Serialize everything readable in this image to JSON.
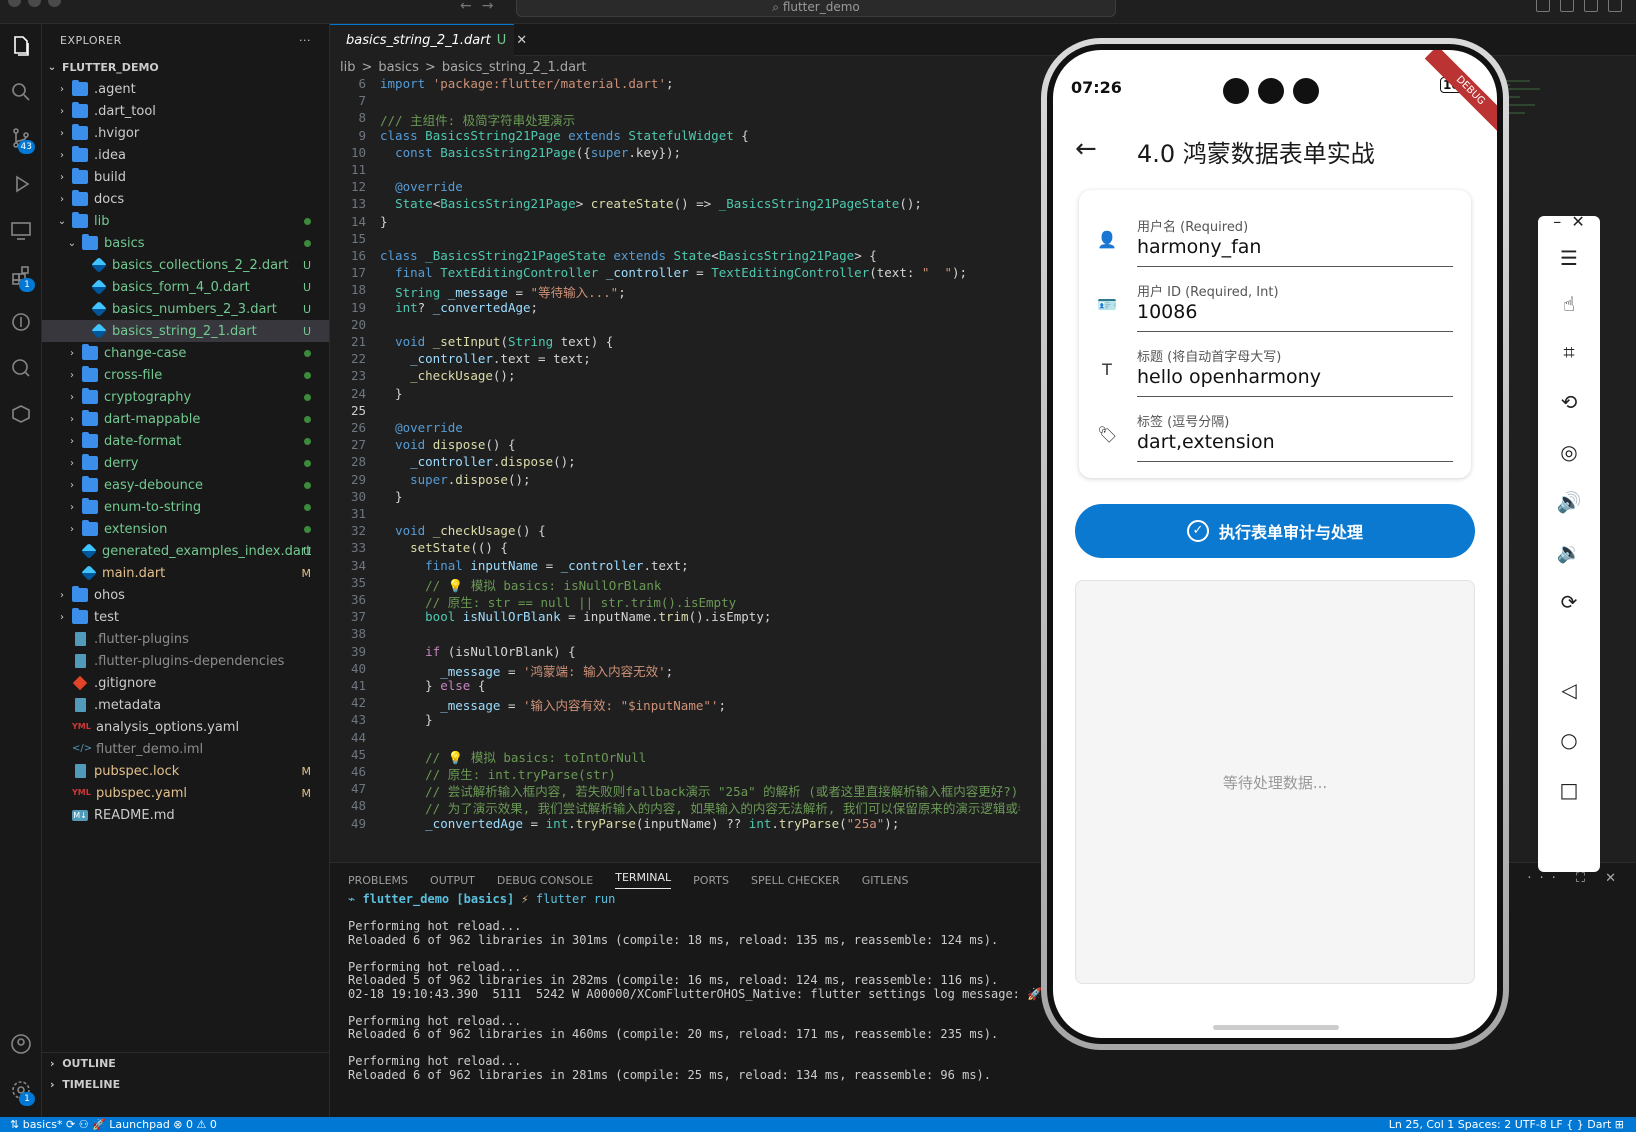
{
  "window": {
    "search": "flutter_demo"
  },
  "explorer": {
    "title": "EXPLORER",
    "more": "···",
    "root": "FLUTTER_DEMO",
    "items": [
      {
        "label": ".agent",
        "kind": "folder",
        "depth": 0,
        "open": false,
        "status": ""
      },
      {
        "label": ".dart_tool",
        "kind": "folder",
        "depth": 0,
        "open": false,
        "status": ""
      },
      {
        "label": ".hvigor",
        "kind": "folder",
        "depth": 0,
        "open": false,
        "status": ""
      },
      {
        "label": ".idea",
        "kind": "folder",
        "depth": 0,
        "open": false,
        "status": ""
      },
      {
        "label": "build",
        "kind": "folder",
        "depth": 0,
        "open": false,
        "status": ""
      },
      {
        "label": "docs",
        "kind": "folder",
        "depth": 0,
        "open": false,
        "status": ""
      },
      {
        "label": "lib",
        "kind": "folder",
        "depth": 0,
        "open": true,
        "status": "dot",
        "color": "green"
      },
      {
        "label": "basics",
        "kind": "folder",
        "depth": 1,
        "open": true,
        "status": "dot",
        "color": "green"
      },
      {
        "label": "basics_collections_2_2.dart",
        "kind": "dart",
        "depth": 2,
        "status": "U",
        "color": "green"
      },
      {
        "label": "basics_form_4_0.dart",
        "kind": "dart",
        "depth": 2,
        "status": "U",
        "color": "green"
      },
      {
        "label": "basics_numbers_2_3.dart",
        "kind": "dart",
        "depth": 2,
        "status": "U",
        "color": "green"
      },
      {
        "label": "basics_string_2_1.dart",
        "kind": "dart",
        "depth": 2,
        "status": "U",
        "color": "green",
        "selected": true
      },
      {
        "label": "change-case",
        "kind": "folder",
        "depth": 1,
        "open": false,
        "status": "dot",
        "color": "green"
      },
      {
        "label": "cross-file",
        "kind": "folder",
        "depth": 1,
        "open": false,
        "status": "dot",
        "color": "green"
      },
      {
        "label": "cryptography",
        "kind": "folder",
        "depth": 1,
        "open": false,
        "status": "dot",
        "color": "green"
      },
      {
        "label": "dart-mappable",
        "kind": "folder",
        "depth": 1,
        "open": false,
        "status": "dot",
        "color": "green"
      },
      {
        "label": "date-format",
        "kind": "folder",
        "depth": 1,
        "open": false,
        "status": "dot",
        "color": "green"
      },
      {
        "label": "derry",
        "kind": "folder",
        "depth": 1,
        "open": false,
        "status": "dot",
        "color": "green"
      },
      {
        "label": "easy-debounce",
        "kind": "folder",
        "depth": 1,
        "open": false,
        "status": "dot",
        "color": "green"
      },
      {
        "label": "enum-to-string",
        "kind": "folder",
        "depth": 1,
        "open": false,
        "status": "dot",
        "color": "green"
      },
      {
        "label": "extension",
        "kind": "folder",
        "depth": 1,
        "open": false,
        "status": "dot",
        "color": "green"
      },
      {
        "label": "generated_examples_index.dart",
        "kind": "dart",
        "depth": 1,
        "status": "U",
        "color": "green"
      },
      {
        "label": "main.dart",
        "kind": "dart",
        "depth": 1,
        "status": "M",
        "color": "yellow"
      },
      {
        "label": "ohos",
        "kind": "folder",
        "depth": 0,
        "open": false,
        "status": ""
      },
      {
        "label": "test",
        "kind": "folder",
        "depth": 0,
        "open": false,
        "status": ""
      },
      {
        "label": ".flutter-plugins",
        "kind": "file",
        "depth": 0,
        "status": "",
        "color": "dim"
      },
      {
        "label": ".flutter-plugins-dependencies",
        "kind": "file",
        "depth": 0,
        "status": "",
        "color": "dim"
      },
      {
        "label": ".gitignore",
        "kind": "git",
        "depth": 0,
        "status": ""
      },
      {
        "label": ".metadata",
        "kind": "file",
        "depth": 0,
        "status": ""
      },
      {
        "label": "analysis_options.yaml",
        "kind": "yaml",
        "depth": 0,
        "status": ""
      },
      {
        "label": "flutter_demo.iml",
        "kind": "xml",
        "depth": 0,
        "status": "",
        "color": "dim"
      },
      {
        "label": "pubspec.lock",
        "kind": "file",
        "depth": 0,
        "status": "M",
        "color": "yellow"
      },
      {
        "label": "pubspec.yaml",
        "kind": "yaml",
        "depth": 0,
        "status": "M",
        "color": "yellow"
      },
      {
        "label": "README.md",
        "kind": "md",
        "depth": 0,
        "status": ""
      }
    ],
    "outline": "OUTLINE",
    "timeline": "TIMELINE"
  },
  "activity": {
    "scm_badge": "43",
    "ext_badge": "1",
    "settings_badge": "1"
  },
  "editor": {
    "tab_label": "basics_string_2_1.dart",
    "tab_status": "U",
    "breadcrumb": [
      "lib",
      ">",
      "basics",
      ">",
      "basics_string_2_1.dart"
    ],
    "current_line": "25",
    "lines": [
      [
        "6",
        "<span class=\"kw\">import</span> <span class=\"st\">'package:flutter/material.dart'</span>;"
      ],
      [
        "7",
        ""
      ],
      [
        "8",
        "<span class=\"cm\">/// 主组件: 极简字符串处理演示</span>"
      ],
      [
        "9",
        "<span class=\"kw\">class</span> <span class=\"ty\">BasicsString21Page</span> <span class=\"kw\">extends</span> <span class=\"ty\">StatefulWidget</span> {"
      ],
      [
        "10",
        "  <span class=\"kw\">const</span> <span class=\"ty\">BasicsString21Page</span>({<span class=\"kw\">super</span>.key});"
      ],
      [
        "11",
        ""
      ],
      [
        "12",
        "  <span class=\"kw\">@override</span>"
      ],
      [
        "13",
        "  <span class=\"ty\">State</span>&lt;<span class=\"ty\">BasicsString21Page</span>&gt; <span class=\"fn\">createState</span>() =&gt; <span class=\"ty\">_BasicsString21PageState</span>();"
      ],
      [
        "14",
        "}"
      ],
      [
        "15",
        ""
      ],
      [
        "16",
        "<span class=\"kw\">class</span> <span class=\"ty\">_BasicsString21PageState</span> <span class=\"kw\">extends</span> <span class=\"ty\">State</span>&lt;<span class=\"ty\">BasicsString21Page</span>&gt; {"
      ],
      [
        "17",
        "  <span class=\"kw\">final</span> <span class=\"ty\">TextEditingController</span> <span class=\"vr\">_controller</span> = <span class=\"ty\">TextEditingController</span>(text: <span class=\"st\">\"  \"</span>);"
      ],
      [
        "18",
        "  <span class=\"ty\">String</span> <span class=\"vr\">_message</span> = <span class=\"st\">\"等待输入...\"</span>;"
      ],
      [
        "19",
        "  <span class=\"ty\">int</span>? <span class=\"vr\">_convertedAge</span>;"
      ],
      [
        "20",
        ""
      ],
      [
        "21",
        "  <span class=\"kw\">void</span> <span class=\"fn\">_setInput</span>(<span class=\"ty\">String</span> text) {"
      ],
      [
        "22",
        "    <span class=\"vr\">_controller</span>.text = text;"
      ],
      [
        "23",
        "    <span class=\"fn\">_checkUsage</span>();"
      ],
      [
        "24",
        "  }"
      ],
      [
        "25",
        ""
      ],
      [
        "26",
        "  <span class=\"kw\">@override</span>"
      ],
      [
        "27",
        "  <span class=\"kw\">void</span> <span class=\"fn\">dispose</span>() {"
      ],
      [
        "28",
        "    <span class=\"vr\">_controller</span>.<span class=\"fn\">dispose</span>();"
      ],
      [
        "29",
        "    <span class=\"kw\">super</span>.<span class=\"fn\">dispose</span>();"
      ],
      [
        "30",
        "  }"
      ],
      [
        "31",
        ""
      ],
      [
        "32",
        "  <span class=\"kw\">void</span> <span class=\"fn\">_checkUsage</span>() {"
      ],
      [
        "33",
        "    <span class=\"fn\">setState</span>(() {"
      ],
      [
        "34",
        "      <span class=\"kw\">final</span> <span class=\"vr\">inputName</span> = <span class=\"vr\">_controller</span>.text;"
      ],
      [
        "35",
        "      <span class=\"cm\">// 💡 模拟 basics: isNullOrBlank</span>"
      ],
      [
        "36",
        "      <span class=\"cm\">// 原生: str == null || str.trim().isEmpty</span>"
      ],
      [
        "37",
        "      <span class=\"ty\">bool</span> <span class=\"vr\">isNullOrBlank</span> = inputName.<span class=\"fn\">trim</span>().isEmpty;"
      ],
      [
        "38",
        ""
      ],
      [
        "39",
        "      <span class=\"dc\">if</span> (isNullOrBlank) {"
      ],
      [
        "40",
        "        <span class=\"vr\">_message</span> = <span class=\"st\">'鸿蒙端: 输入内容无效'</span>;"
      ],
      [
        "41",
        "      } <span class=\"dc\">else</span> {"
      ],
      [
        "42",
        "        <span class=\"vr\">_message</span> = <span class=\"st\">'输入内容有效: \"$inputName\"'</span>;"
      ],
      [
        "43",
        "      }"
      ],
      [
        "44",
        ""
      ],
      [
        "45",
        "      <span class=\"cm\">// 💡 模拟 basics: toIntOrNull</span>"
      ],
      [
        "46",
        "      <span class=\"cm\">// 原生: int.tryParse(str)</span>"
      ],
      [
        "47",
        "      <span class=\"cm\">// 尝试解析输入框内容, 若失败则fallback演示 \"25a\" 的解析 (或者这里直接解析输入框内容更好?)</span>"
      ],
      [
        "48",
        "      <span class=\"cm\">// 为了演示效果, 我们尝试解析输入的内容, 如果输入的内容无法解析, 我们可以保留原来的演示逻辑或者直接</span>"
      ],
      [
        "49",
        "      <span class=\"vr\">_convertedAge</span> = <span class=\"ty\">int</span>.<span class=\"fn\">tryParse</span>(inputName) ?? <span class=\"ty\">int</span>.<span class=\"fn\">tryParse</span>(<span class=\"st\">\"25a\"</span>);"
      ]
    ]
  },
  "panel": {
    "tabs": [
      "PROBLEMS",
      "OUTPUT",
      "DEBUG CONSOLE",
      "TERMINAL",
      "PORTS",
      "SPELL CHECKER",
      "GITLENS"
    ],
    "active_tab": "TERMINAL",
    "prompt_dir": "flutter_demo",
    "prompt_branch": "[basics]",
    "prompt_cmd": "flutter run",
    "terminal_lines": [
      "",
      "Performing hot reload...",
      "Reloaded 6 of 962 libraries in 301ms (compile: 18 ms, reload: 135 ms, reassemble: 124 ms).",
      "",
      "Performing hot reload...",
      "Reloaded 5 of 962 libraries in 282ms (compile: 16 ms, reload: 124 ms, reassemble: 116 ms).",
      "02-18 19:10:43.390  5111  5242 W A00000/XComFlutterOHOS_Native: flutter settings log message: 🚀 [",
      "",
      "Performing hot reload...",
      "Reloaded 6 of 962 libraries in 460ms (compile: 20 ms, reload: 171 ms, reassemble: 235 ms).",
      "",
      "Performing hot reload...",
      "Reloaded 6 of 962 libraries in 281ms (compile: 25 ms, reload: 134 ms, reassemble: 96 ms)."
    ]
  },
  "statusbar": {
    "left": "⇅ basics*  ⟳  ⚇  🚀 Launchpad  ⊗ 0 ⚠ 0",
    "right": "Ln 25, Col 1    Spaces: 2    UTF-8    LF    { } Dart    ⊞"
  },
  "phone": {
    "time": "07:26",
    "battery": "100",
    "debug_banner": "DEBUG",
    "title": "4.0 鸿蒙数据表单实战",
    "fields": [
      {
        "icon": "person-icon",
        "glyph": "👤",
        "label": "用户名 (Required)",
        "value": "harmony_fan"
      },
      {
        "icon": "badge-icon",
        "glyph": "🪪",
        "label": "用户 ID (Required, Int)",
        "value": "10086"
      },
      {
        "icon": "text-icon",
        "glyph": "T",
        "label": "标题 (将自动首字母大写)",
        "value": "hello openharmony"
      },
      {
        "icon": "label-icon",
        "glyph": "🏷",
        "label": "标签 (逗号分隔)",
        "value": "dart,extension"
      }
    ],
    "submit_label": "执行表单审计与处理",
    "result_placeholder": "等待处理数据..."
  },
  "colors": {
    "accent": "#0078d4",
    "button": "#0b79d0"
  }
}
